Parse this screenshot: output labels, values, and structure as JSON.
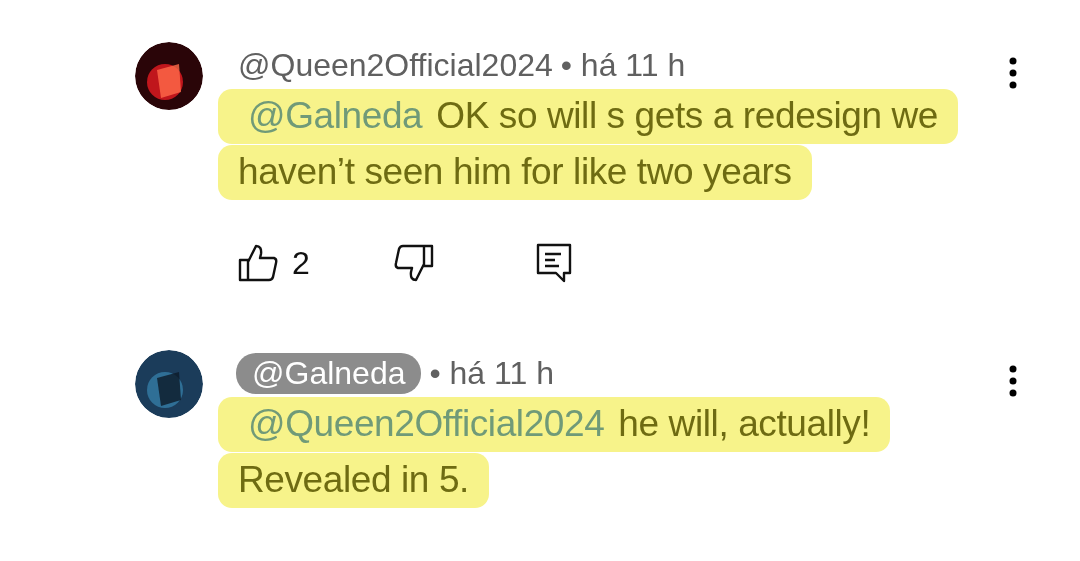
{
  "comments": [
    {
      "author": "@Queen2Official2024",
      "owner_badge": false,
      "time": "• há 11 h",
      "mention": "@Galneda",
      "text": "OK so will s gets a redesign we haven’t seen him for like two years",
      "likes": "2"
    },
    {
      "author": "@Galneda",
      "owner_badge": true,
      "time": "• há 11 h",
      "mention": "@Queen2Official2024",
      "text": "he will, actually! Revealed in 5."
    }
  ]
}
